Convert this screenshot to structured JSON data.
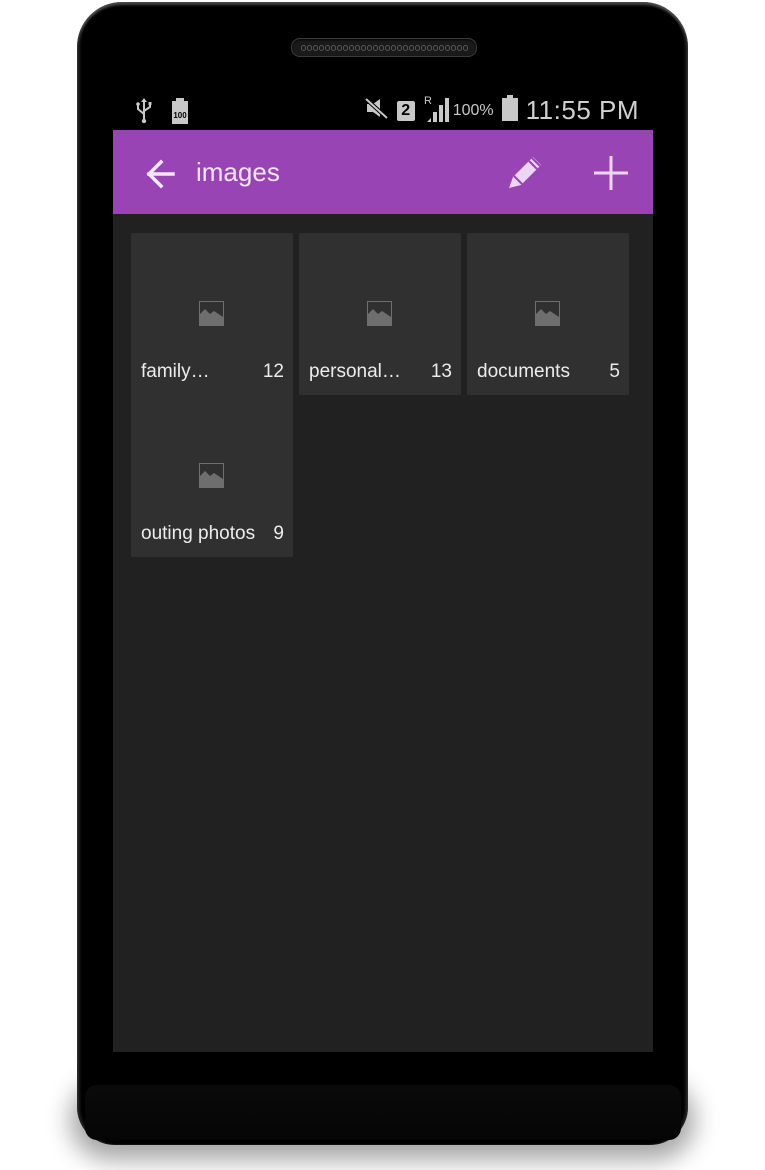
{
  "status_bar": {
    "left_icons": [
      "usb-icon",
      "battery-100-icon"
    ],
    "battery_small_label": "100",
    "mute_icon": "mute-icon",
    "sim_label": "2",
    "roaming_label": "R",
    "signal_icon": "signal-icon",
    "battery_percent": "100%",
    "time": "11:55 PM"
  },
  "app_bar": {
    "back_icon": "arrow-left-icon",
    "title": "images",
    "actions": [
      {
        "name": "edit",
        "icon": "pencil-icon"
      },
      {
        "name": "add",
        "icon": "plus-icon"
      }
    ],
    "color": "#9944b4"
  },
  "albums": [
    {
      "name": "family…",
      "count": "12"
    },
    {
      "name": "personal…",
      "count": "13"
    },
    {
      "name": "documents",
      "count": "5"
    },
    {
      "name": "outing photos",
      "count": "9"
    }
  ],
  "colors": {
    "screen_bg": "#212121",
    "tile_bg": "#303030",
    "accent": "#9944b4"
  }
}
